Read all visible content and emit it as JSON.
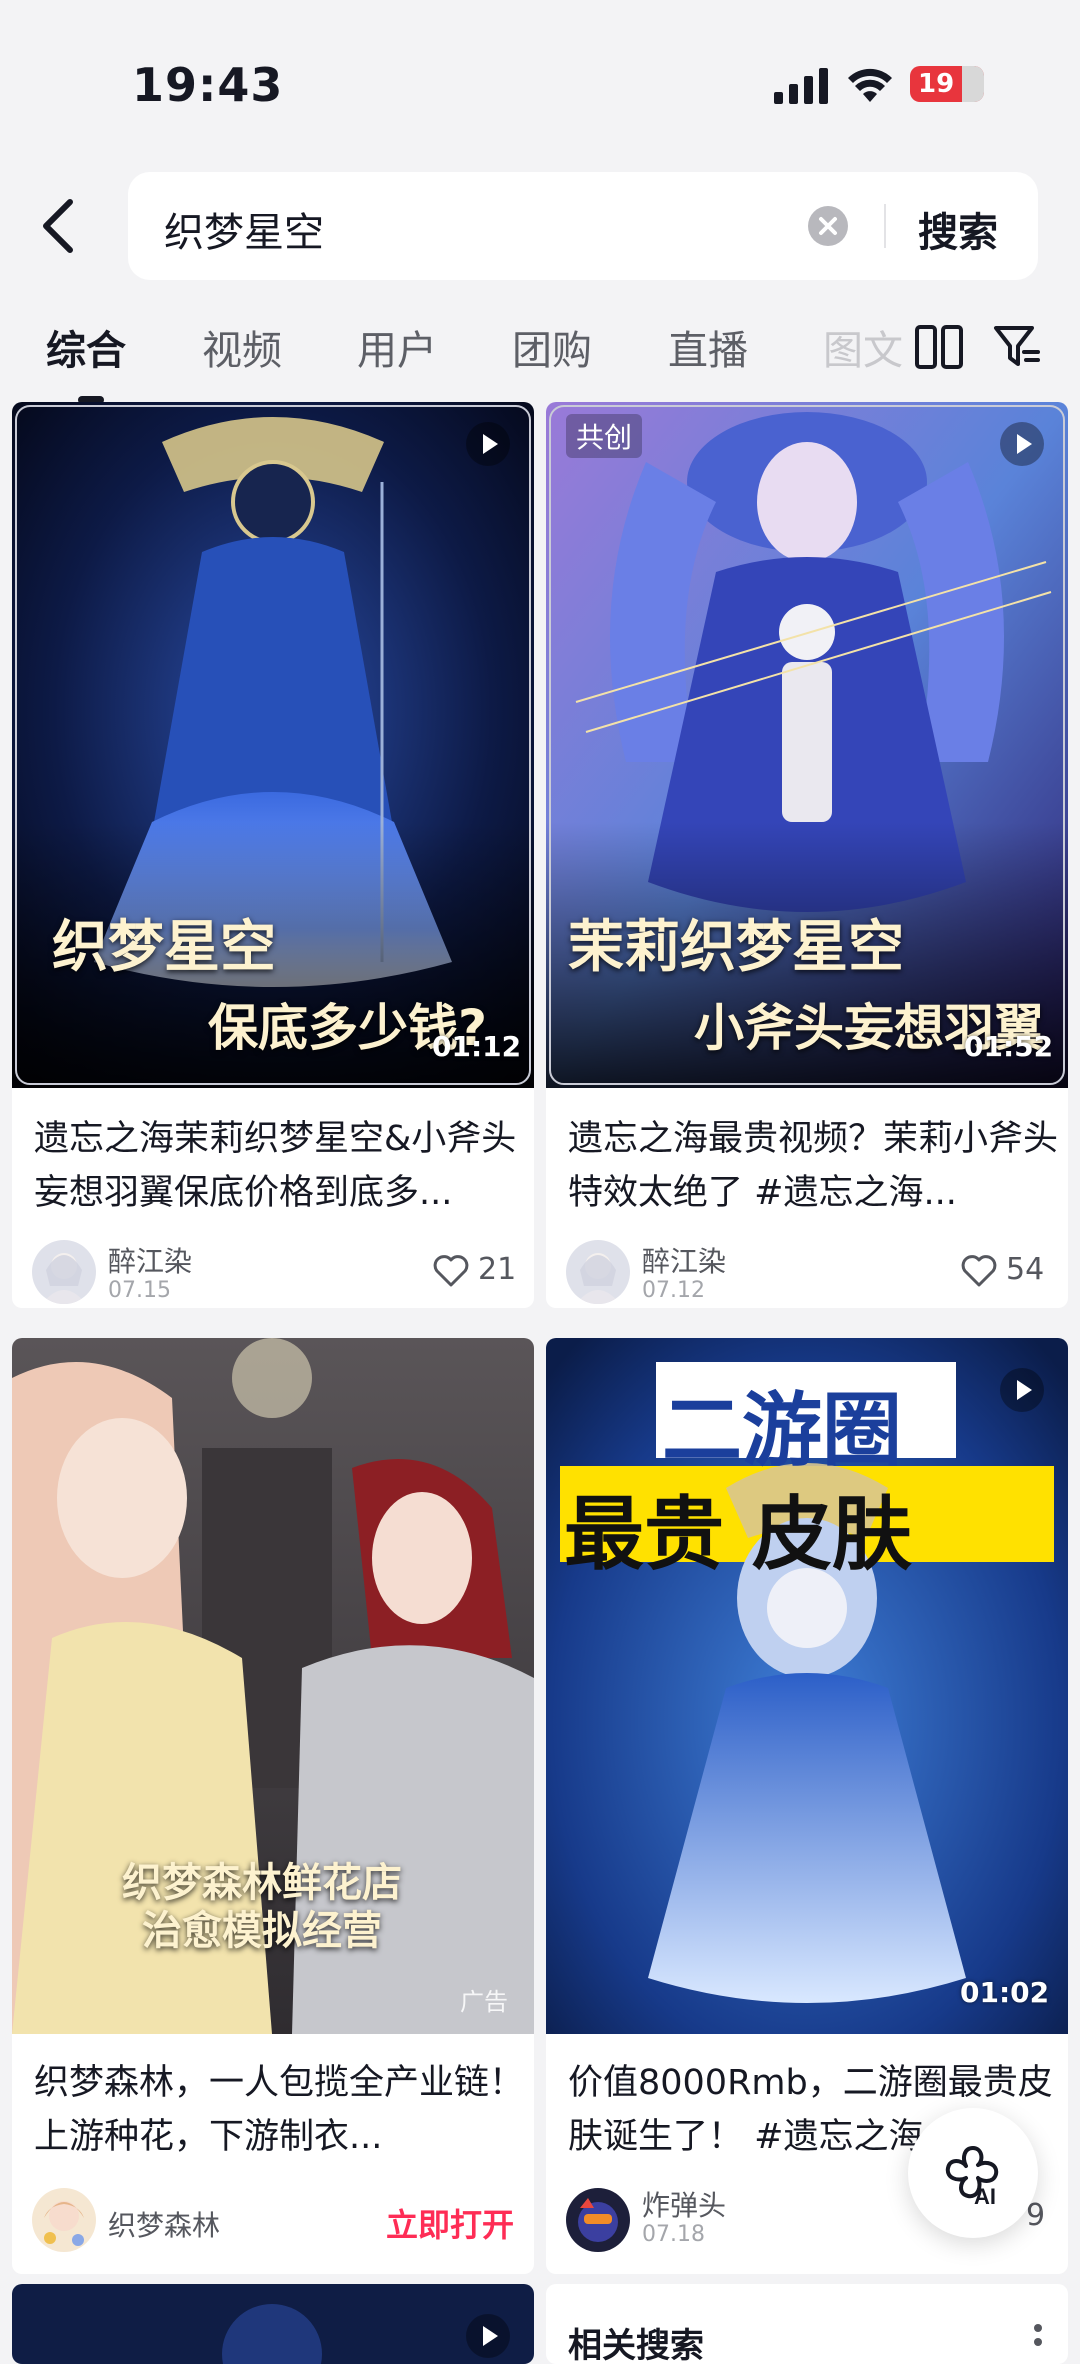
{
  "status_bar": {
    "time": "19:43",
    "battery": "19"
  },
  "search": {
    "query": "织梦星空",
    "submit_label": "搜索"
  },
  "tabs": [
    {
      "label": "综合"
    },
    {
      "label": "视频"
    },
    {
      "label": "用户"
    },
    {
      "label": "团购"
    },
    {
      "label": "直播"
    },
    {
      "label": "图文"
    }
  ],
  "cards": [
    {
      "overlay_line1": "织梦星空",
      "overlay_line2": "保底多少钱?",
      "duration": "01:12",
      "title": "遗忘之海茉莉织梦星空&小斧头妄想羽翼保底价格到底多...",
      "author": "醉江染",
      "date": "07.15",
      "likes": "21"
    },
    {
      "badge": "共创",
      "overlay_line1": "茉莉织梦星空",
      "overlay_line2": "小斧头妄想羽翼",
      "duration": "01:52",
      "title": "遗忘之海最贵视频？茉莉小斧头特效太绝了 #遗忘之海...",
      "author": "醉江染",
      "date": "07.12",
      "likes": "54"
    },
    {
      "overlay_line1": "织梦森林鲜花店",
      "overlay_line2": "治愈模拟经营",
      "ad_tag": "广告",
      "title": "织梦森林，一人包揽全产业链！上游种花，下游制衣...",
      "author": "织梦森林",
      "action": "立即打开"
    },
    {
      "overlay_line1": "二游圈",
      "overlay_line2": "最贵 皮肤",
      "duration": "01:02",
      "title": "价值8000Rmb，二游圈最贵皮肤诞生了！ #遗忘之海...",
      "author": "炸弹头",
      "date": "07.18",
      "likes": "9"
    }
  ],
  "related": {
    "title": "相关搜索"
  },
  "ai_button": {
    "label": "AI"
  }
}
